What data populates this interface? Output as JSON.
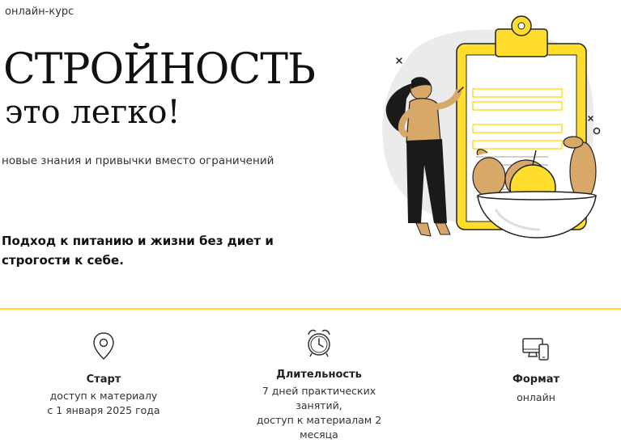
{
  "hero": {
    "eyebrow": "онлайн-курс",
    "title_line1": "СТРОЙНОСТЬ",
    "title_line2": "это легко!",
    "subtitle": "новые знания и привычки вместо ограничений",
    "lead": "Подход к питанию и жизни без диет и строгости к себе."
  },
  "features": [
    {
      "icon": "location-pin-icon",
      "title": "Старт",
      "line1": "доступ к материалу",
      "line2": "с 1 января 2025 года"
    },
    {
      "icon": "alarm-clock-icon",
      "title": "Длительность",
      "line1": "7 дней практических занятий,",
      "line2": "доступ к материалам 2 месяца"
    },
    {
      "icon": "devices-icon",
      "title": "Формат",
      "line1": "онлайн"
    }
  ],
  "colors": {
    "accent": "#ffdd2d",
    "text": "#1a1a1a",
    "skin": "#d8a869",
    "pants": "#1a1a1a"
  }
}
